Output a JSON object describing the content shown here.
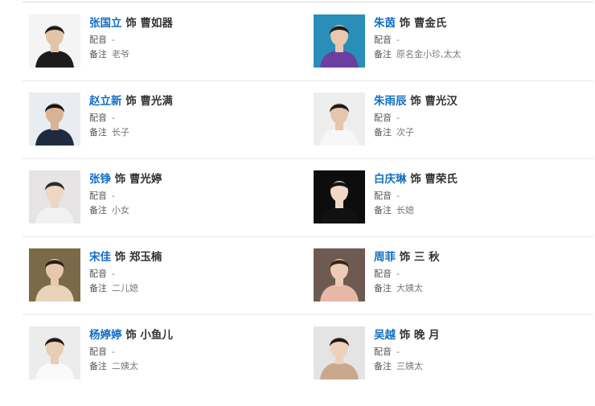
{
  "cast": [
    {
      "actor": "张国立",
      "sep": "饰",
      "role": "曹如器",
      "dub_label": "配音",
      "dub": "-",
      "note_label": "备注",
      "note": "老爷",
      "bg": "#f4f4f4",
      "skin": "#e3c4a8",
      "hair": "#1a1a1a",
      "cloth": "#1c1c1c"
    },
    {
      "actor": "朱茵",
      "sep": "饰",
      "role": "曹金氏",
      "dub_label": "配音",
      "dub": "-",
      "note_label": "备注",
      "note": "原名金小珍,太太",
      "bg": "#2a8fb8",
      "skin": "#e8c8b0",
      "hair": "#1e1e1e",
      "cloth": "#6b3fa0"
    },
    {
      "actor": "赵立新",
      "sep": "饰",
      "role": "曹光满",
      "dub_label": "配音",
      "dub": "-",
      "note_label": "备注",
      "note": "长子",
      "bg": "#e9edf2",
      "skin": "#d9b296",
      "hair": "#151515",
      "cloth": "#1f2a3e"
    },
    {
      "actor": "朱雨辰",
      "sep": "饰",
      "role": "曹光汉",
      "dub_label": "配音",
      "dub": "-",
      "note_label": "备注",
      "note": "次子",
      "bg": "#eeeeee",
      "skin": "#e4c6ac",
      "hair": "#1c1c1c",
      "cloth": "#f7f7f7"
    },
    {
      "actor": "张铮",
      "sep": "饰",
      "role": "曹光婷",
      "dub_label": "配音",
      "dub": "-",
      "note_label": "备注",
      "note": "小女",
      "bg": "#e7e4e6",
      "skin": "#efd6c4",
      "hair": "#2b2b2b",
      "cloth": "#f2f2f2"
    },
    {
      "actor": "白庆琳",
      "sep": "饰",
      "role": "曹荣氏",
      "dub_label": "配音",
      "dub": "-",
      "note_label": "备注",
      "note": "长媳",
      "bg": "#0d0d0d",
      "skin": "#f0d8c8",
      "hair": "#141414",
      "cloth": "#111111"
    },
    {
      "actor": "宋佳",
      "sep": "饰",
      "role": "郑玉楠",
      "dub_label": "配音",
      "dub": "-",
      "note_label": "备注",
      "note": "二儿媳",
      "bg": "#7a6a48",
      "skin": "#e6c9ad",
      "hair": "#2a1e14",
      "cloth": "#e8d4b8"
    },
    {
      "actor": "周菲",
      "sep": "饰",
      "role": "三 秋",
      "dub_label": "配音",
      "dub": "-",
      "note_label": "备注",
      "note": "大姨太",
      "bg": "#6e5a50",
      "skin": "#ecccb6",
      "hair": "#3a2418",
      "cloth": "#e8b8a6"
    },
    {
      "actor": "杨婷婷",
      "sep": "饰",
      "role": "小鱼儿",
      "dub_label": "配音",
      "dub": "-",
      "note_label": "备注",
      "note": "二姨太",
      "bg": "#ececec",
      "skin": "#e8ccb4",
      "hair": "#1e1a18",
      "cloth": "#fafafa"
    },
    {
      "actor": "吴越",
      "sep": "饰",
      "role": "晚 月",
      "dub_label": "配音",
      "dub": "-",
      "note_label": "备注",
      "note": "三姨太",
      "bg": "#e4e4e4",
      "skin": "#ecd2bc",
      "hair": "#221a16",
      "cloth": "#c9a88e"
    }
  ]
}
